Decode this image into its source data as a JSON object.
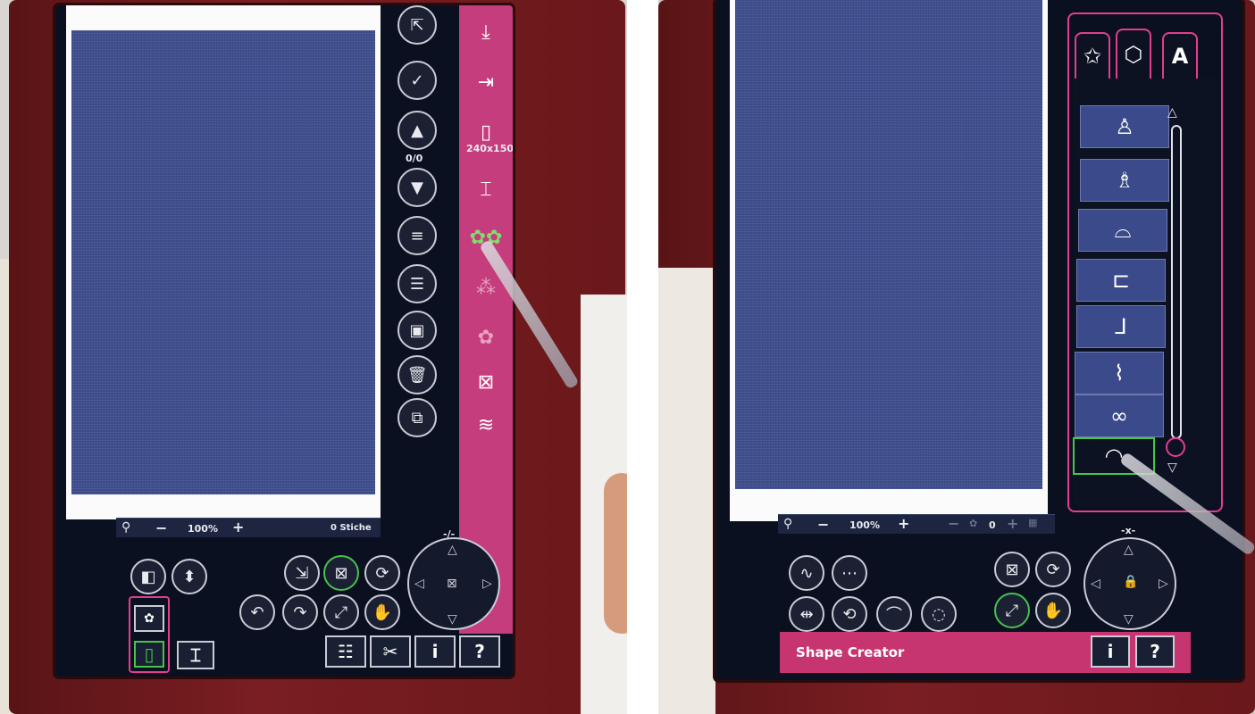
{
  "left_screen": {
    "zoom_value": "100%",
    "zoom_minus": "−",
    "zoom_plus": "+",
    "stitch_count": "0 Stiche",
    "page_counter": "0/0",
    "hoop_size": "240x150",
    "move_mode": "-/-",
    "help_label": "?",
    "info_label": "i"
  },
  "right_screen": {
    "zoom_value": "100%",
    "zoom_minus": "−",
    "zoom_plus": "+",
    "repeat_count": "0",
    "move_mode": "-x-",
    "status_title": "Shape Creator",
    "tabs": [
      "☆",
      "shield",
      "A"
    ],
    "shapes": [
      "person",
      "person-skirt",
      "car",
      "van",
      "boot",
      "high-heel",
      "glasses",
      "lips"
    ],
    "selected_shape": "lips",
    "help_label": "?",
    "info_label": "i"
  },
  "colors": {
    "accent_pink": "#c63d7d",
    "screen_bg": "#0b1020",
    "fabric": "#3f4e8e",
    "selected_green": "#47c24d",
    "housing": "#6d1a1d"
  }
}
